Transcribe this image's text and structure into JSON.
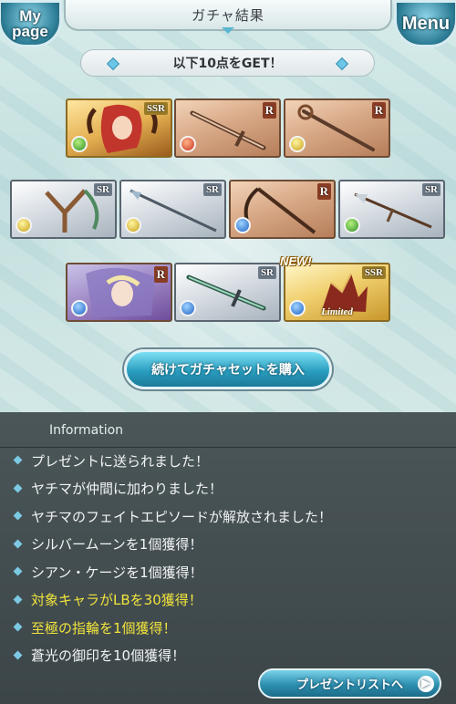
{
  "header": {
    "title": "ガチャ結果",
    "mypage_label_1": "My",
    "mypage_label_2": "page",
    "menu_label": "Menu"
  },
  "banner": {
    "text": "以下10点をGET！"
  },
  "cards": [
    {
      "rarity": "SSR",
      "type": "character",
      "element": "wind"
    },
    {
      "rarity": "R",
      "type": "weapon",
      "element": "fire",
      "icon": "sword-icon"
    },
    {
      "rarity": "R",
      "type": "weapon",
      "element": "light",
      "icon": "staff-icon"
    },
    {
      "rarity": "SR",
      "type": "weapon",
      "element": "light",
      "icon": "slingshot-icon"
    },
    {
      "rarity": "SR",
      "type": "weapon",
      "element": "light",
      "icon": "spear-icon"
    },
    {
      "rarity": "R",
      "type": "weapon",
      "element": "water",
      "icon": "scythe-icon"
    },
    {
      "rarity": "SR",
      "type": "weapon",
      "element": "wind",
      "icon": "spear-icon"
    },
    {
      "rarity": "R",
      "type": "character",
      "element": "water"
    },
    {
      "rarity": "SR",
      "type": "weapon",
      "element": "water",
      "icon": "sword-icon"
    },
    {
      "rarity": "SSR",
      "type": "summon",
      "element": "water",
      "badge": "NEW!",
      "label": "Limited"
    }
  ],
  "buy_button": {
    "label": "続けてガチャセットを購入"
  },
  "information": {
    "title": "Information",
    "items": [
      {
        "text": "プレゼントに送られました！",
        "highlight": false
      },
      {
        "text": "ヤチマが仲間に加わりました！",
        "highlight": false
      },
      {
        "text": "ヤチマのフェイトエピソードが解放されました！",
        "highlight": false
      },
      {
        "text": "シルバームーンを1個獲得！",
        "highlight": false
      },
      {
        "text": "シアン・ケージを1個獲得！",
        "highlight": false
      },
      {
        "text": "対象キャラがLBを30獲得！",
        "highlight": true
      },
      {
        "text": "至極の指輪を1個獲得！",
        "highlight": true
      },
      {
        "text": "蒼光の御印を10個獲得！",
        "highlight": false
      }
    ]
  },
  "present_button": {
    "label": "プレゼントリストへ"
  },
  "colors": {
    "highlight": "#f1e33d",
    "accent": "#2a9ec0"
  }
}
